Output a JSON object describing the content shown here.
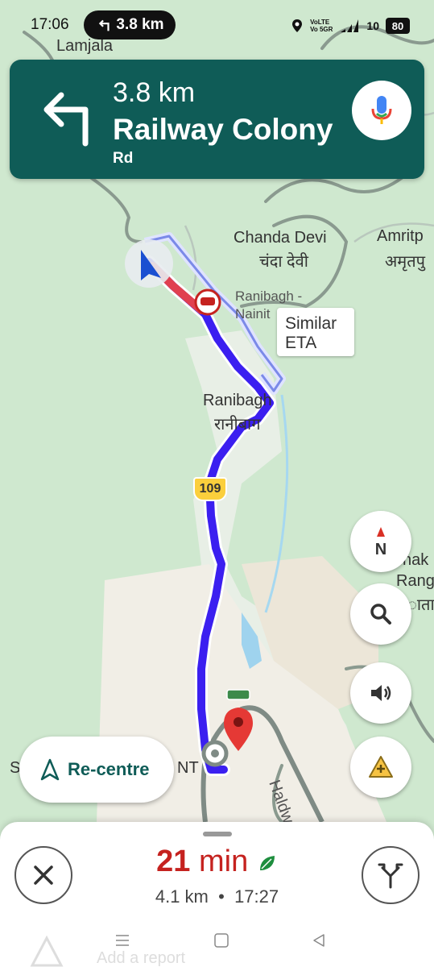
{
  "status_bar": {
    "time": "17:06",
    "pill_distance": "3.8 km",
    "volte_line1": "VoLTE",
    "volte_line2": "Vo 5GR",
    "signal_text": "10",
    "battery": "80"
  },
  "nav_banner": {
    "distance": "3.8 km",
    "street": "Railway Colony",
    "street_suffix": "Rd"
  },
  "map": {
    "labels": {
      "lamjala": "Lamjala",
      "chanda_devi": "Chanda Devi",
      "chanda_devi_hi": "चंदा देवी",
      "amritpur": "Amritp",
      "amritpur_hi": "अमृतपु",
      "ranibagh_station": "Ranibagh -",
      "ranibagh_station_2": "Nainit",
      "ranibagh": "Ranibagh",
      "ranibagh_hi": "रानीबाग",
      "nak": "nak",
      "rang": "Rang",
      "rang_hi": "ाता",
      "haldwani": "Haldw",
      "s_label": "S",
      "nt_label": "NT"
    },
    "eta_chip_line1": "Similar",
    "eta_chip_line2": "ETA",
    "route_shield": "109",
    "compass_label": "N"
  },
  "recentre_label": "Re-centre",
  "bottom_sheet": {
    "eta_minutes": "21",
    "eta_unit": "min",
    "distance": "4.1 km",
    "separator": "•",
    "arrival_time": "17:27"
  },
  "system_nav": {
    "add_report": "Add a report"
  },
  "colors": {
    "banner": "#0f5c57",
    "route": "#3b1ff0",
    "eta_red": "#c5221f"
  }
}
